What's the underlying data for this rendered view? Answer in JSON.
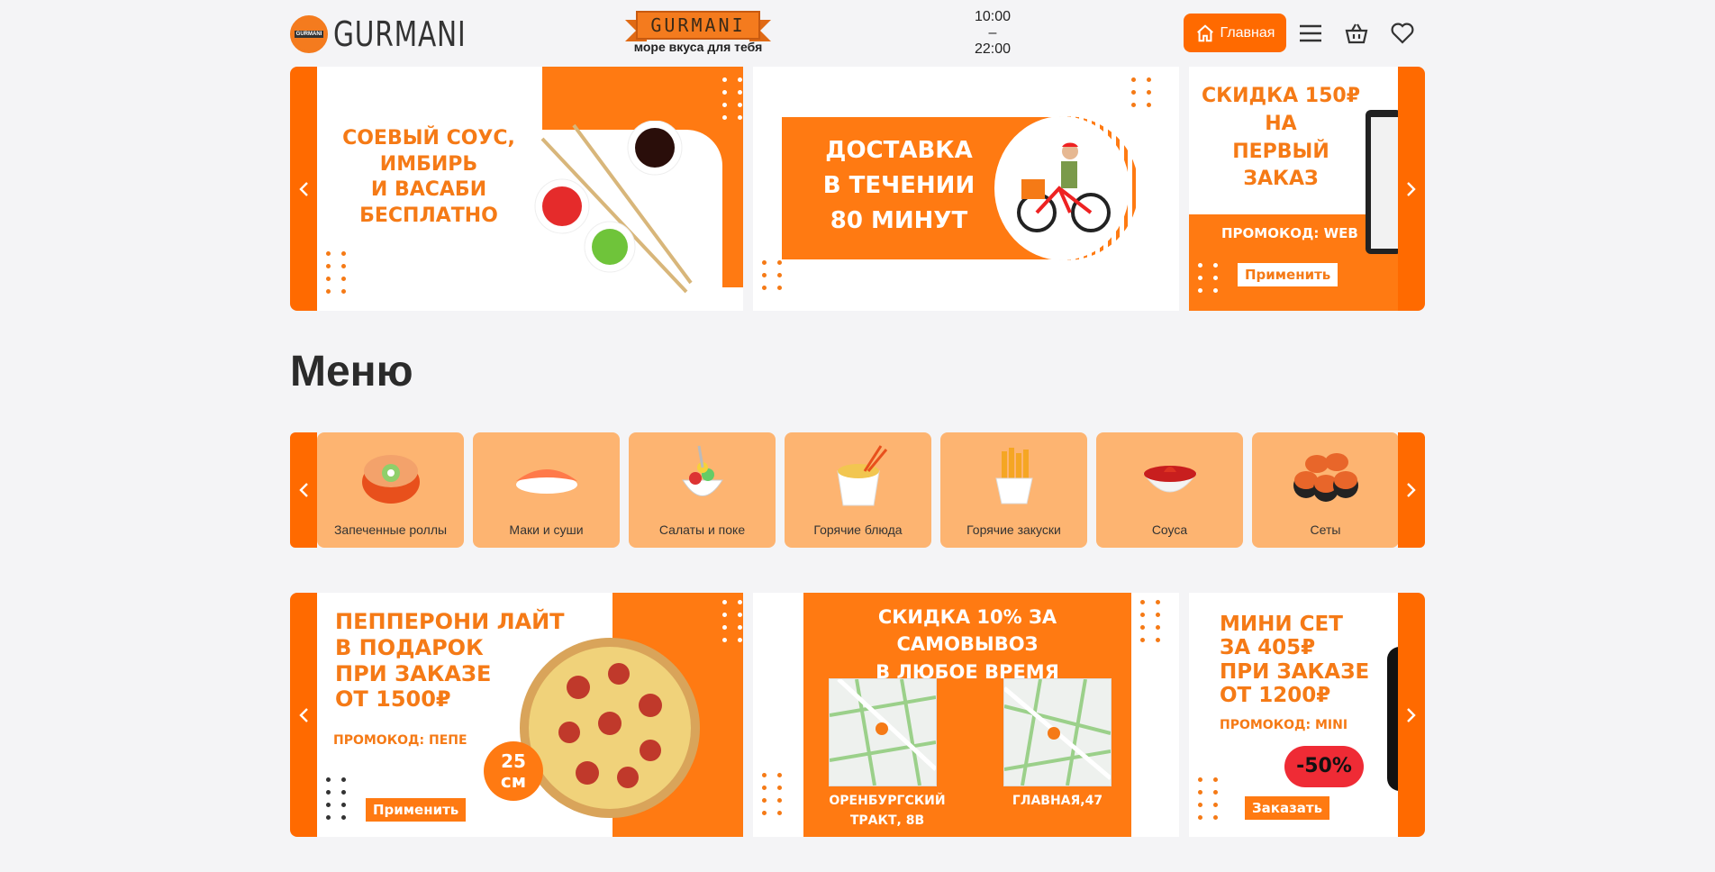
{
  "header": {
    "logo_text": "GURMANI",
    "logo_badge": "GURMANI",
    "center_logo": "GURMANI",
    "tagline": "море вкуса для тебя",
    "hours_open": "10:00",
    "hours_sep": "–",
    "hours_close": "22:00",
    "home_label": "Главная"
  },
  "colors": {
    "accent": "#ff6a00",
    "promo": "#f57a16",
    "category_bg": "#fdb471",
    "page_bg": "#f4f4f6"
  },
  "top_banners": [
    {
      "lines": [
        "Соевый соус,",
        "имбирь",
        "и васаби",
        "бесплатно"
      ]
    },
    {
      "lines": [
        "Доставка",
        "в течении",
        "80 минут"
      ]
    },
    {
      "lines": [
        "Скидка 150₽",
        "на",
        "первый",
        "заказ"
      ],
      "promo": "Промокод: WEB",
      "button": "Применить"
    }
  ],
  "menu": {
    "title": "Меню",
    "categories": [
      {
        "label": "Запеченные роллы",
        "icon": "baked-roll-icon"
      },
      {
        "label": "Маки и суши",
        "icon": "sushi-icon"
      },
      {
        "label": "Салаты и поке",
        "icon": "salad-icon"
      },
      {
        "label": "Горячие блюда",
        "icon": "noodle-box-icon"
      },
      {
        "label": "Горячие закуски",
        "icon": "fries-icon"
      },
      {
        "label": "Соуса",
        "icon": "sauce-bowl-icon"
      },
      {
        "label": "Сеты",
        "icon": "roll-set-icon"
      }
    ]
  },
  "bottom_banners": [
    {
      "lines": [
        "Пепперони лайт",
        "в подарок",
        "при заказе",
        "от 1500₽"
      ],
      "promo": "Промокод: ПЕПЕ",
      "badge_lines": [
        "25",
        "см"
      ],
      "button": "Применить"
    },
    {
      "lines": [
        "Скидка 10% за самовывоз",
        "в любое время"
      ],
      "address_1_lines": [
        "Оренбургский",
        "тракт, 8В"
      ],
      "address_2": "Главная,47"
    },
    {
      "lines": [
        "Мини сет",
        "за 405₽",
        "при заказе",
        "от 1200₽"
      ],
      "promo": "Промокод: MINI",
      "discount": "-50%",
      "button": "Заказать"
    }
  ]
}
